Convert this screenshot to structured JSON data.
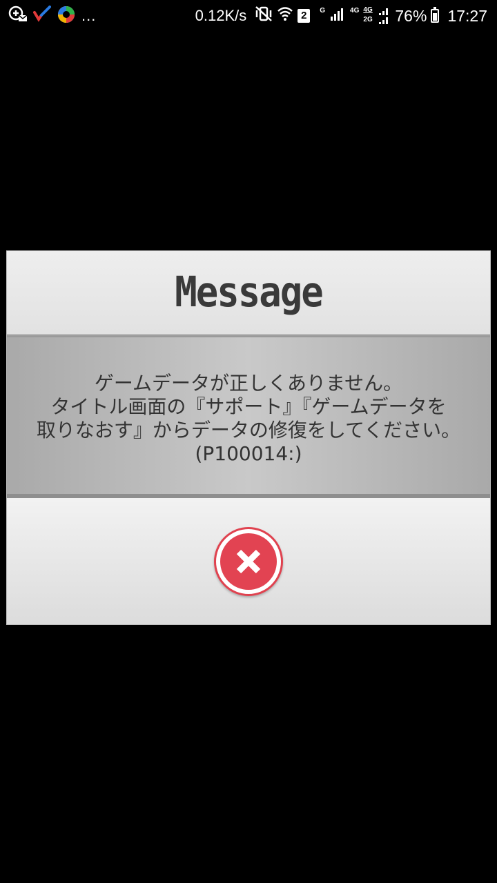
{
  "status_bar": {
    "left_icons": [
      "vpn-mail-icon",
      "checkmark-app-icon",
      "colorful-app-icon"
    ],
    "overflow": "...",
    "net_speed": "0.12K/s",
    "sim_number": "2",
    "network_g": "G",
    "network_4g": "4G",
    "network_4g2g_top": "4G",
    "network_4g2g_bottom": "2G",
    "battery_percent": "76%",
    "battery_level": 0.76,
    "time": "17:27"
  },
  "dialog": {
    "title": "Message",
    "message": "ゲームデータが正しくありません。\nタイトル画面の『サポート』『ゲームデータを\n取りなおす』からデータの修復をしてください。\n(P100014:)",
    "close_icon": "close-x-icon"
  },
  "colors": {
    "accent_red": "#e24352",
    "background": "#000000",
    "dialog_gray": "#d8d8d8"
  }
}
